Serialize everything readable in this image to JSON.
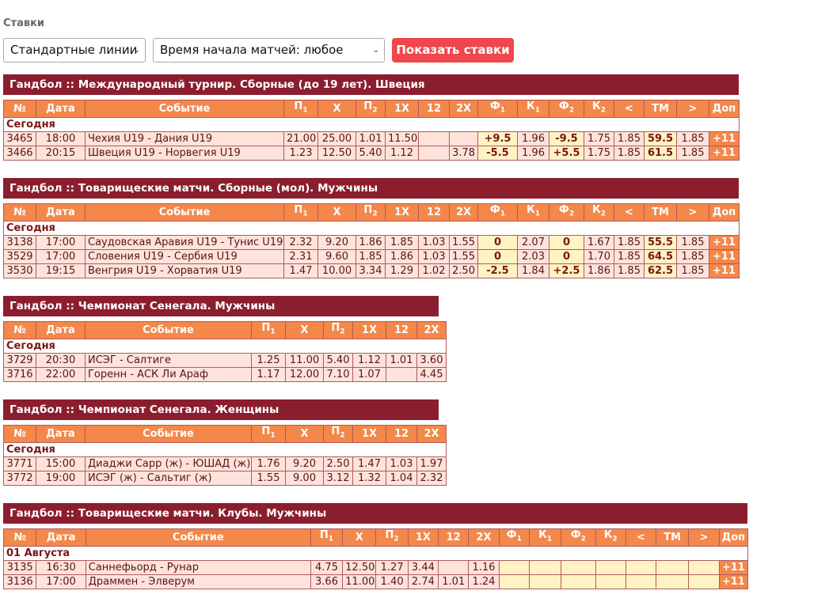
{
  "page": {
    "title": "Ставки"
  },
  "controls": {
    "lines_select": "Стандартные линии",
    "time_select": "Время начала матчей: любое",
    "show_button": "Показать ставки"
  },
  "columns_full": [
    "№",
    "Дата",
    "Событие",
    "П",
    "1",
    "Х",
    "П",
    "2",
    "1Х",
    "12",
    "2Х",
    "Ф",
    "1",
    "К",
    "1",
    "Ф",
    "2",
    "К",
    "2",
    "<",
    "ТМ",
    ">",
    "Доп"
  ],
  "columns_short": [
    "№",
    "Дата",
    "Событие",
    "П",
    "1",
    "Х",
    "П",
    "2",
    "1Х",
    "12",
    "2Х"
  ],
  "blocks": [
    {
      "title": "Гандбол :: Международный турнир. Сборные (до 19 лет). Швеция",
      "day": "Сегодня",
      "rows": [
        [
          "3465",
          "18:00",
          "Чехия U19 - Дания U19",
          "21.00",
          "25.00",
          "1.01",
          "11.50",
          "",
          "",
          "+9.5",
          "1.96",
          "-9.5",
          "1.75",
          "1.85",
          "59.5",
          "1.85",
          "+11"
        ],
        [
          "3466",
          "20:15",
          "Швеция U19 - Норвегия U19",
          "1.23",
          "12.50",
          "5.40",
          "1.12",
          "",
          "3.78",
          "-5.5",
          "1.96",
          "+5.5",
          "1.75",
          "1.85",
          "61.5",
          "1.85",
          "+11"
        ]
      ]
    },
    {
      "title": "Гандбол :: Товарищеские матчи. Сборные (мол). Мужчины",
      "day": "Сегодня",
      "rows": [
        [
          "3138",
          "17:00",
          "Саудовская Аравия U19 - Тунис U19",
          "2.32",
          "9.20",
          "1.86",
          "1.85",
          "1.03",
          "1.55",
          "0",
          "2.07",
          "0",
          "1.67",
          "1.85",
          "55.5",
          "1.85",
          "+11"
        ],
        [
          "3529",
          "17:00",
          "Словения U19 - Сербия U19",
          "2.31",
          "9.60",
          "1.85",
          "1.86",
          "1.03",
          "1.55",
          "0",
          "2.03",
          "0",
          "1.70",
          "1.85",
          "64.5",
          "1.85",
          "+11"
        ],
        [
          "3530",
          "19:15",
          "Венгрия U19 - Хорватия U19",
          "1.47",
          "10.00",
          "3.34",
          "1.29",
          "1.02",
          "2.50",
          "-2.5",
          "1.84",
          "+2.5",
          "1.86",
          "1.85",
          "62.5",
          "1.85",
          "+11"
        ]
      ]
    },
    {
      "title": "Гандбол :: Чемпионат Сенегала. Мужчины",
      "day": "Сегодня",
      "rows": [
        [
          "3729",
          "20:30",
          "ИСЭГ - Салтиге",
          "1.25",
          "11.00",
          "5.40",
          "1.12",
          "1.01",
          "3.60"
        ],
        [
          "3716",
          "22:00",
          "Горенн - АСК Ли Араф",
          "1.17",
          "12.00",
          "7.10",
          "1.07",
          "",
          "4.45"
        ]
      ]
    },
    {
      "title": "Гандбол :: Чемпионат Сенегала. Женщины",
      "day": "Сегодня",
      "rows": [
        [
          "3771",
          "15:00",
          "Диаджи Сарр (ж) - ЮШАД (ж)",
          "1.76",
          "9.20",
          "2.50",
          "1.47",
          "1.03",
          "1.97"
        ],
        [
          "3772",
          "19:00",
          "ИСЭГ (ж) - Сальтиг (ж)",
          "1.55",
          "9.00",
          "3.12",
          "1.32",
          "1.04",
          "2.32"
        ]
      ]
    },
    {
      "title": "Гандбол :: Товарищеские матчи. Клубы. Мужчины",
      "day": "01 Августа",
      "rows": [
        [
          "3135",
          "16:30",
          "Саннефьорд - Рунар",
          "4.75",
          "12.50",
          "1.27",
          "3.44",
          "",
          "1.16",
          "",
          "",
          "",
          "",
          "",
          "",
          "",
          "+11"
        ],
        [
          "3136",
          "17:00",
          "Драммен - Элверум",
          "3.66",
          "11.00",
          "1.40",
          "2.74",
          "1.01",
          "1.24",
          "",
          "",
          "",
          "",
          "",
          "",
          "",
          "+11"
        ]
      ]
    }
  ]
}
